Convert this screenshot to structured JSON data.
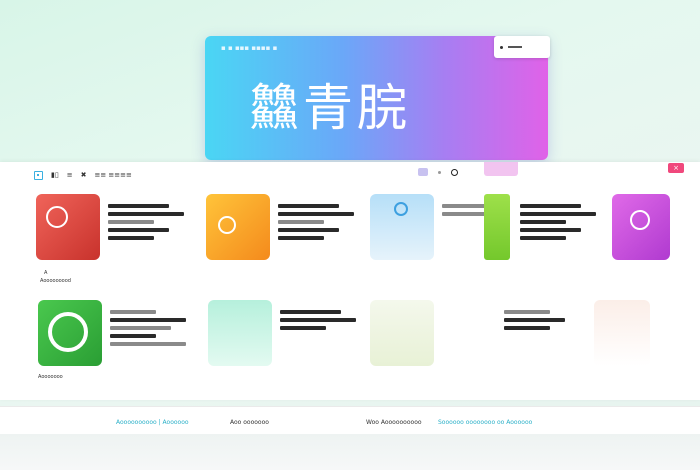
{
  "hero": {
    "title": "䲜青脘",
    "tag_label": "—",
    "badge_text": ""
  },
  "toolbar": {
    "items": [
      "▮▯",
      "≡",
      "✖",
      "≡≡ ≡≡≡≡"
    ]
  },
  "labels": {
    "card1_caption": "A",
    "card1_sub": "Aooooooood",
    "card6_sub": "Aooooooo"
  },
  "footer": {
    "items": [
      "Aoooooooooo | Aoooooo",
      "Aoo ooooooo",
      "Woo Aoooooooooo",
      "Soooooo oooooooo oo Aoooooo"
    ]
  },
  "colors": {
    "hero_start": "#4ad6f4",
    "hero_end": "#e062e8",
    "accent_teal": "#2bb0c8",
    "accent_pink": "#f0487c"
  }
}
